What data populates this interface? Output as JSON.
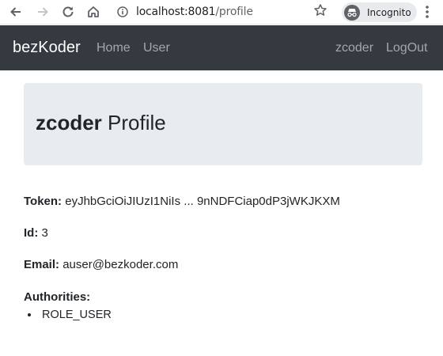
{
  "browser": {
    "url_host": "localhost:8081",
    "url_path": "/profile",
    "incognito_label": "Incognito"
  },
  "navbar": {
    "brand": "bezKoder",
    "links": [
      "Home",
      "User"
    ],
    "user": "zcoder",
    "logout": "LogOut"
  },
  "profile": {
    "username": "zcoder",
    "title_suffix": "Profile",
    "token_label": "Token:",
    "token_value": "eyJhbGciOiJIUzI1NiIs ... 9nNDFCiap0dP3jWKJKXM",
    "id_label": "Id:",
    "id_value": "3",
    "email_label": "Email:",
    "email_value": "auser@bezkoder.com",
    "authorities_label": "Authorities:",
    "authorities": [
      "ROLE_USER"
    ]
  }
}
